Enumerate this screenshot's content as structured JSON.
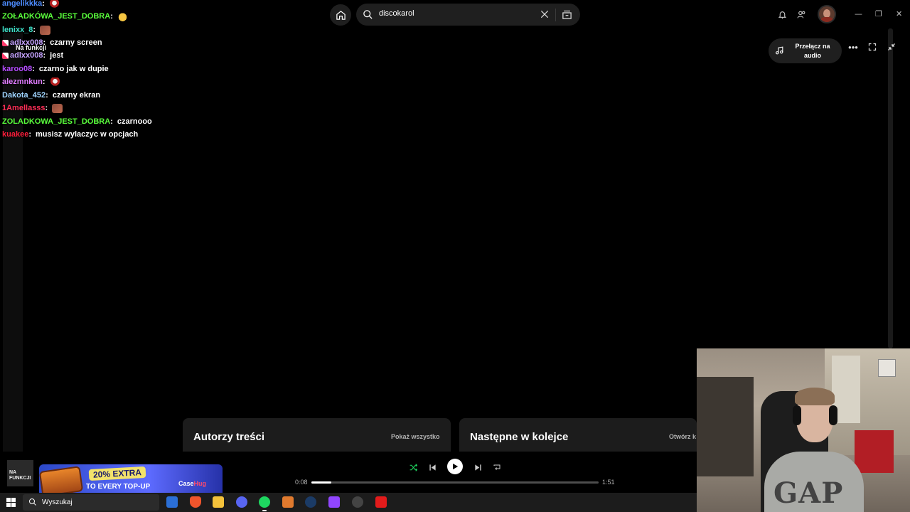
{
  "search": {
    "value": "discokarol"
  },
  "header": {
    "audio_button_label": "Przełącz na audio"
  },
  "chat": {
    "overlay_note": "Na funkcji",
    "messages": [
      {
        "user": "angelikkka",
        "color": "#4d8cff",
        "text": "",
        "emote": "red"
      },
      {
        "user": "ZOŁADKÓWA_JEST_DOBRA",
        "color": "#5aff3c",
        "text": "",
        "emote": "yellow"
      },
      {
        "user": "lenixx_8",
        "color": "#3ce0c8",
        "text": "",
        "emote": "brown"
      },
      {
        "user": "adlxx008",
        "color": "#c4a2ff",
        "text": "czarny screen",
        "emote": "",
        "badge": true
      },
      {
        "user": "adlxx008",
        "color": "#c4a2ff",
        "text": "jest",
        "emote": "",
        "badge": true
      },
      {
        "user": "karoo08",
        "color": "#b54cff",
        "text": "czarno jak w dupie",
        "emote": ""
      },
      {
        "user": "alezmnkun",
        "color": "#e07cff",
        "text": "",
        "emote": "red"
      },
      {
        "user": "Dakota_452",
        "color": "#9fd4ff",
        "text": "czarny ekran",
        "emote": ""
      },
      {
        "user": "1Amellasss",
        "color": "#ff2e57",
        "text": "",
        "emote": "brown"
      },
      {
        "user": "ZOLADKOWA_JEST_DOBRA",
        "color": "#5aff3c",
        "text": "czarnooo",
        "emote": ""
      },
      {
        "user": "kuakee",
        "color": "#ff1e3c",
        "text": "musisz wylaczyc w opcjach",
        "emote": ""
      }
    ]
  },
  "panels": {
    "creators": {
      "title": "Autorzy treści",
      "link": "Pokaż wszystko"
    },
    "queue": {
      "title": "Następne w kolejce",
      "link": "Otwórz k"
    }
  },
  "player": {
    "track_title": "Na",
    "cover_text": "NA FUNKCJI",
    "elapsed": "0:08",
    "duration": "1:51",
    "progress": 0.07
  },
  "ad": {
    "headline": "20% EXTRA",
    "subline": "TO EVERY TOP-UP",
    "brand_prefix": "Case",
    "brand_suffix": "Hug"
  },
  "taskbar": {
    "search_placeholder": "Wyszukaj"
  },
  "colors": {
    "accent_green": "#1ed760",
    "background": "#000000",
    "surface": "#1f1f1f"
  }
}
